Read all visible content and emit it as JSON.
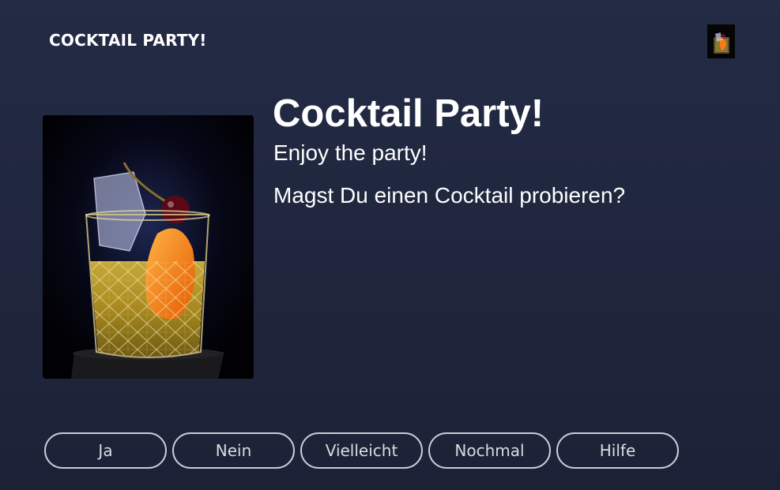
{
  "header": {
    "title": "COCKTAIL PARTY!",
    "thumbnail_icon": "cocktail-thumbnail"
  },
  "main": {
    "title": "Cocktail Party!",
    "subtitle": "Enjoy the party!",
    "prompt": "Magst Du einen Cocktail probieren?",
    "image_icon": "cocktail-glass-image"
  },
  "hints": [
    {
      "label": "Ja"
    },
    {
      "label": "Nein"
    },
    {
      "label": "Vielleicht"
    },
    {
      "label": "Nochmal"
    },
    {
      "label": "Hilfe"
    }
  ],
  "colors": {
    "background": "#232b45",
    "text": "#ffffff",
    "button_border": "#c9ccd6"
  }
}
